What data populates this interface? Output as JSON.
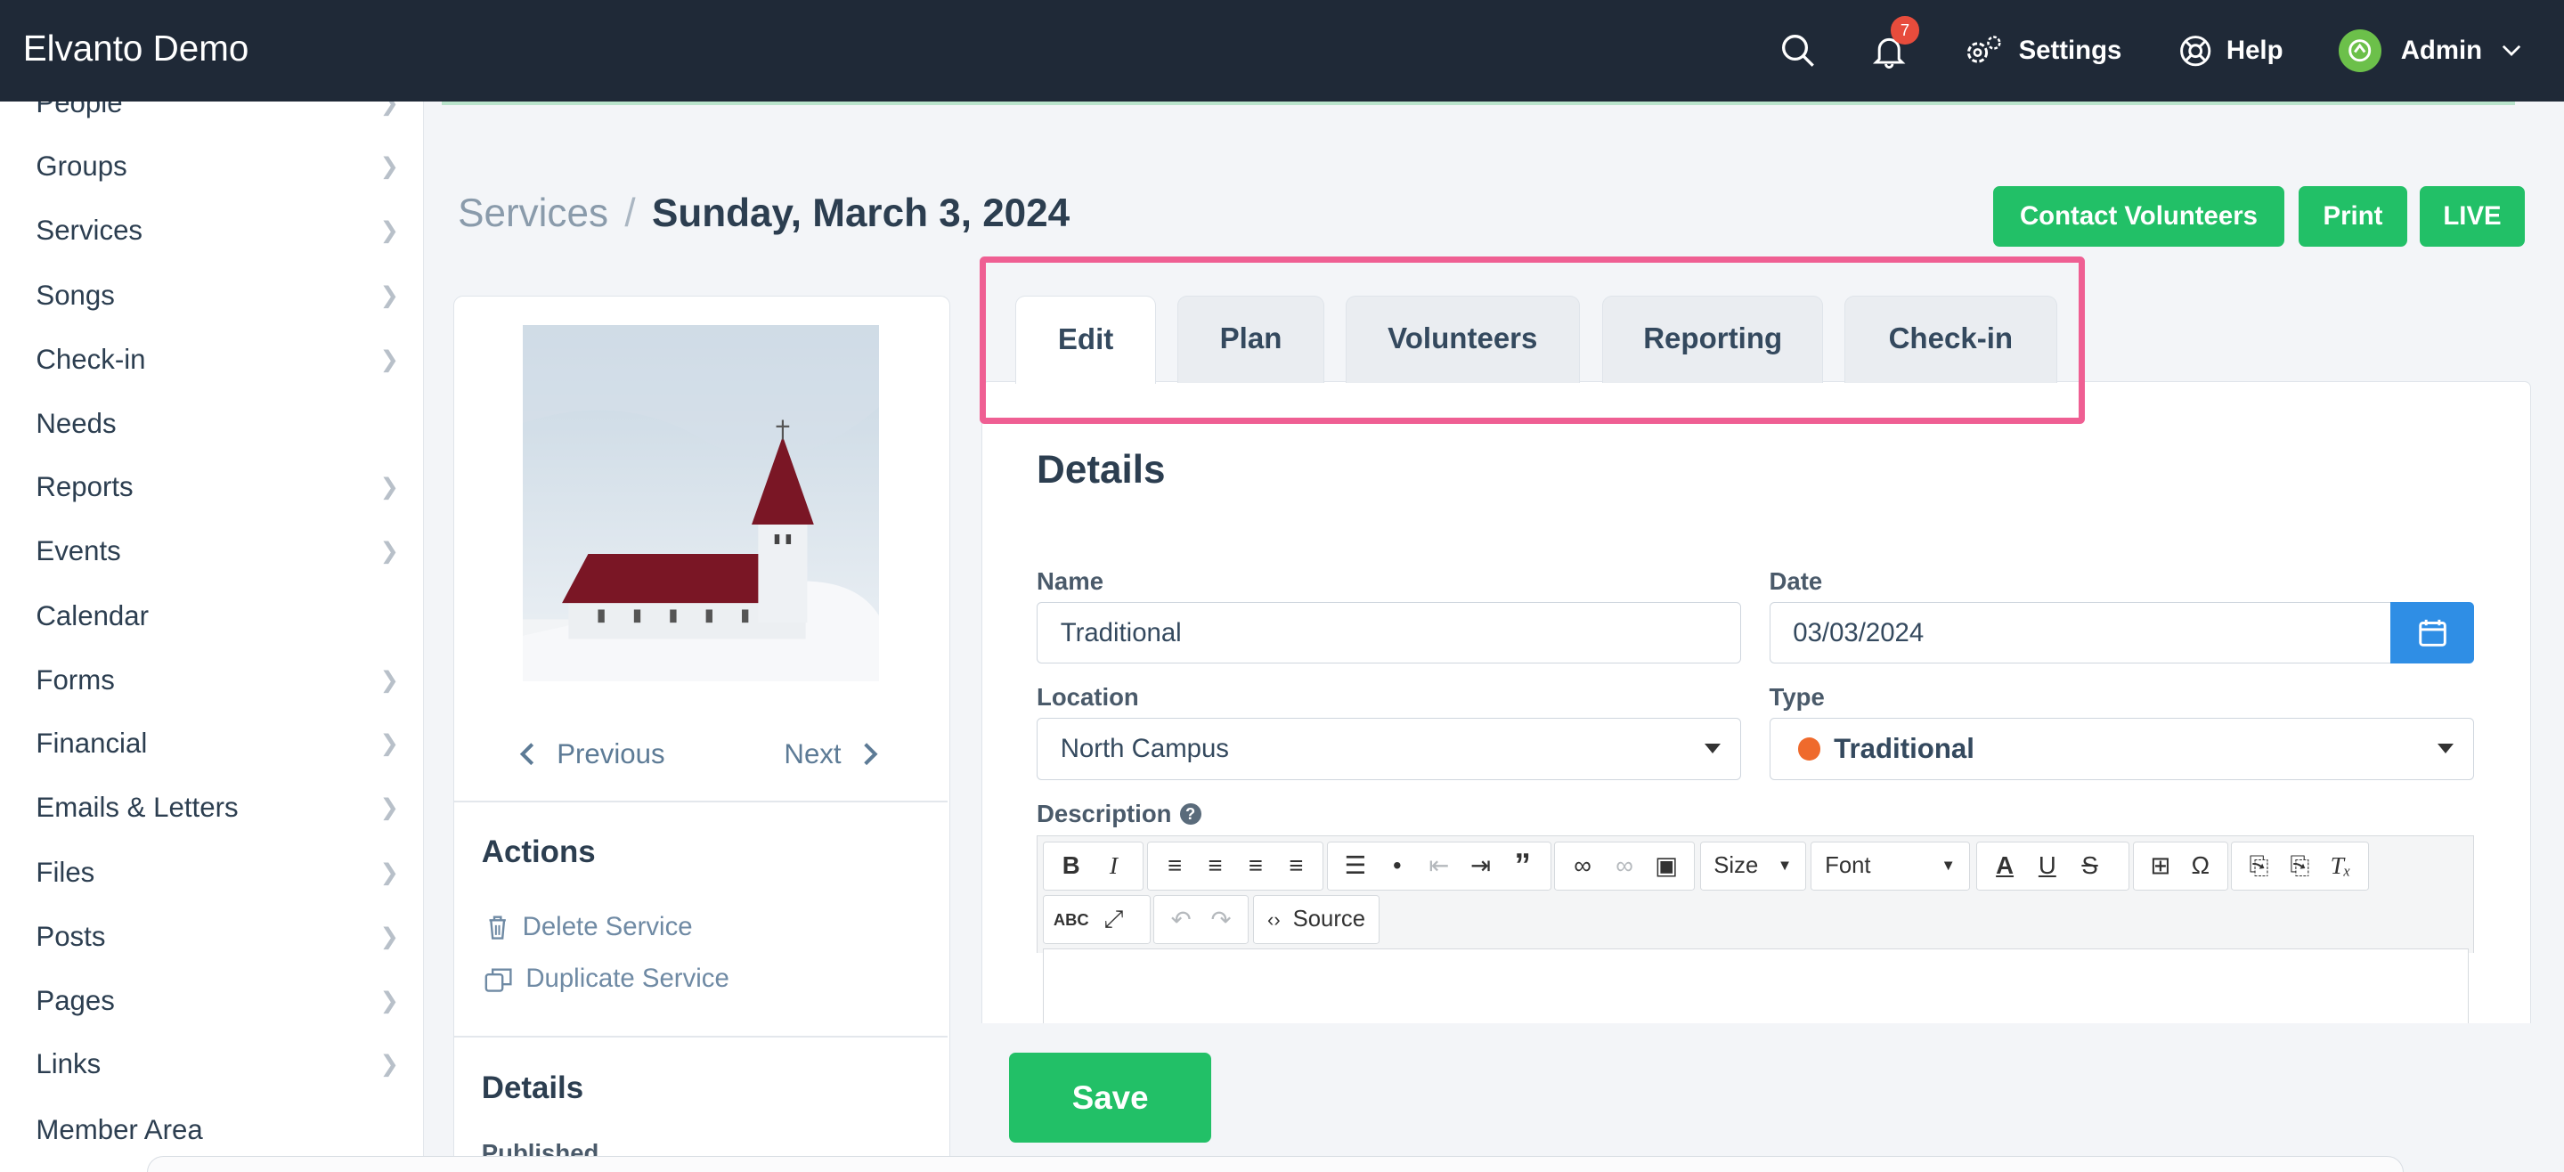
{
  "app": {
    "title": "Elvanto Demo"
  },
  "topnav": {
    "notification_count": "7",
    "settings": "Settings",
    "help": "Help",
    "user": "Admin"
  },
  "sidebar": {
    "items": [
      {
        "label": "People",
        "chevron": true
      },
      {
        "label": "Groups",
        "chevron": true
      },
      {
        "label": "Services",
        "chevron": true
      },
      {
        "label": "Songs",
        "chevron": true
      },
      {
        "label": "Check-in",
        "chevron": true
      },
      {
        "label": "Needs",
        "chevron": false
      },
      {
        "label": "Reports",
        "chevron": true
      },
      {
        "label": "Events",
        "chevron": true
      },
      {
        "label": "Calendar",
        "chevron": false
      },
      {
        "label": "Forms",
        "chevron": true
      },
      {
        "label": "Financial",
        "chevron": true
      },
      {
        "label": "Emails & Letters",
        "chevron": true
      },
      {
        "label": "Files",
        "chevron": true
      },
      {
        "label": "Posts",
        "chevron": true
      },
      {
        "label": "Pages",
        "chevron": true
      },
      {
        "label": "Links",
        "chevron": true
      },
      {
        "label": "Member Area",
        "chevron": false
      }
    ]
  },
  "breadcrumb": {
    "parent": "Services",
    "separator": "/",
    "current": "Sunday, March 3, 2024"
  },
  "header_buttons": {
    "contact": "Contact Volunteers",
    "print": "Print",
    "live": "LIVE"
  },
  "left_panel": {
    "previous": "Previous",
    "next": "Next",
    "actions_title": "Actions",
    "delete": "Delete Service",
    "duplicate": "Duplicate Service",
    "details_title": "Details",
    "published": "Published"
  },
  "tabs": [
    {
      "label": "Edit",
      "active": true
    },
    {
      "label": "Plan",
      "active": false
    },
    {
      "label": "Volunteers",
      "active": false
    },
    {
      "label": "Reporting",
      "active": false
    },
    {
      "label": "Check-in",
      "active": false
    }
  ],
  "form": {
    "title": "Details",
    "name_label": "Name",
    "name_value": "Traditional",
    "date_label": "Date",
    "date_value": "03/03/2024",
    "location_label": "Location",
    "location_value": "North Campus",
    "type_label": "Type",
    "type_value": "Traditional",
    "type_color": "#ef6a2c",
    "description_label": "Description"
  },
  "editor": {
    "size": "Size",
    "font": "Font",
    "source": "Source"
  },
  "save": "Save",
  "colors": {
    "topbar": "#1f2937",
    "accent_green": "#22c067",
    "accent_blue": "#2f8ee5",
    "highlight": "#ef5f93"
  }
}
